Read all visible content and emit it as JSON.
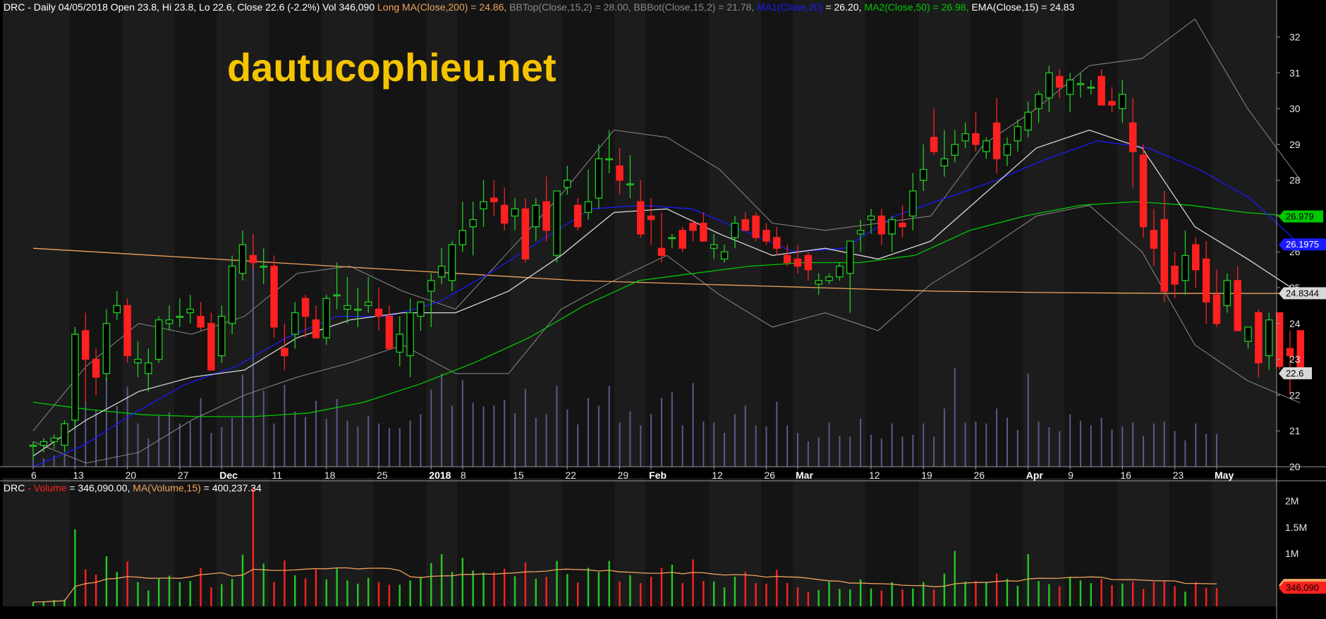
{
  "header": {
    "symbol": "DRC",
    "desc": " - Daily 04/05/2018 Open 23.8, Hi 23.8, Lo 22.6, Close 22.6 (-2.2%) Vol 346,090 ",
    "long_ma": "Long MA(Close,200) = 24.86,",
    "bbtop": " BBTop(Close,15,2) = 28.00,",
    "bbbot": " BBBot(Close,15,2) = 21.78,",
    "ma1_name": " MA1(Close,20)",
    "ma1_val": " = 26.20,",
    "ma2": " MA2(Close,50) = 26.98,",
    "ema": " EMA(Close,15) = 24.83"
  },
  "volume_header": {
    "symbol": "DRC",
    "vol_name": " - Volume",
    "vol_val": " = 346,090.00,",
    "ma_name": " MA(Volume,15)",
    "ma_val": " = 400,237.34"
  },
  "watermark": "dautucophieu.net",
  "colors": {
    "up": "#22cc22",
    "down": "#ff2020",
    "ma200": "#f0a35e",
    "ma20": "#1a1aff",
    "ma50": "#00c800",
    "ema": "#d8d8d8",
    "bb": "#8a8a8a",
    "volbars": "#5a5a8c",
    "watermark": "#f5c400"
  },
  "price_tags": [
    {
      "label": "26.979",
      "value": 26.979,
      "bg": "#00c800",
      "fg": "#000000"
    },
    {
      "label": "26.1975",
      "value": 26.1975,
      "bg": "#1a1aff",
      "fg": "#ffffff"
    },
    {
      "label": "24.8344",
      "value": 24.8344,
      "bg": "#d8d8d8",
      "fg": "#000000"
    },
    {
      "label": "22.6",
      "value": 22.6,
      "bg": "#d8d8d8",
      "fg": "#000000"
    }
  ],
  "volume_tags": [
    {
      "label": "400,237",
      "value": 400237,
      "bg": "#f0a35e",
      "fg": "#000000"
    },
    {
      "label": "346,090",
      "value": 346090,
      "bg": "#ff2020",
      "fg": "#000000"
    }
  ],
  "chart_data": {
    "type": "candlestick",
    "y_ticks": [
      20,
      21,
      22,
      23,
      24,
      25,
      26,
      27,
      28,
      29,
      30,
      31,
      32
    ],
    "ylim": [
      20,
      32.6
    ],
    "volume_ticks": [
      {
        "label": "1M",
        "value": 1000000
      },
      {
        "label": "1.5M",
        "value": 1500000
      },
      {
        "label": "2M",
        "value": 2000000
      }
    ],
    "volume_ylim": [
      0,
      2300000
    ],
    "x_labels": [
      {
        "label": "6",
        "index": 0,
        "bold": false
      },
      {
        "label": "13",
        "index": 4,
        "bold": false
      },
      {
        "label": "20",
        "index": 9,
        "bold": false
      },
      {
        "label": "27",
        "index": 14,
        "bold": false
      },
      {
        "label": "Dec",
        "index": 18,
        "bold": true
      },
      {
        "label": "11",
        "index": 23,
        "bold": false
      },
      {
        "label": "18",
        "index": 28,
        "bold": false
      },
      {
        "label": "25",
        "index": 33,
        "bold": false
      },
      {
        "label": "2018",
        "index": 38,
        "bold": true
      },
      {
        "label": "8",
        "index": 41,
        "bold": false
      },
      {
        "label": "15",
        "index": 46,
        "bold": false
      },
      {
        "label": "22",
        "index": 51,
        "bold": false
      },
      {
        "label": "29",
        "index": 56,
        "bold": false
      },
      {
        "label": "Feb",
        "index": 59,
        "bold": true
      },
      {
        "label": "12",
        "index": 65,
        "bold": false
      },
      {
        "label": "26",
        "index": 70,
        "bold": false
      },
      {
        "label": "Mar",
        "index": 73,
        "bold": true
      },
      {
        "label": "12",
        "index": 80,
        "bold": false
      },
      {
        "label": "19",
        "index": 85,
        "bold": false
      },
      {
        "label": "26",
        "index": 90,
        "bold": false
      },
      {
        "label": "Apr",
        "index": 95,
        "bold": true
      },
      {
        "label": "9",
        "index": 99,
        "bold": false
      },
      {
        "label": "16",
        "index": 104,
        "bold": false
      },
      {
        "label": "23",
        "index": 109,
        "bold": false
      },
      {
        "label": "May",
        "index": 113,
        "bold": true
      }
    ],
    "ohlc": [
      [
        20.6,
        20.7,
        20.2,
        20.6
      ],
      [
        20.6,
        20.8,
        20.4,
        20.7
      ],
      [
        20.7,
        20.9,
        20.5,
        20.8
      ],
      [
        20.6,
        21.3,
        20.4,
        21.2
      ],
      [
        21.3,
        23.9,
        21.1,
        23.7
      ],
      [
        23.8,
        24.3,
        21.8,
        23.0
      ],
      [
        23.0,
        23.3,
        22.0,
        22.5
      ],
      [
        22.6,
        24.4,
        22.4,
        24.0
      ],
      [
        24.3,
        24.9,
        24.1,
        24.5
      ],
      [
        24.5,
        24.7,
        22.9,
        23.1
      ],
      [
        22.9,
        23.5,
        22.5,
        23.0
      ],
      [
        22.6,
        23.3,
        22.1,
        22.9
      ],
      [
        23.0,
        24.2,
        22.9,
        24.1
      ],
      [
        24.0,
        24.5,
        23.8,
        24.1
      ],
      [
        24.2,
        24.7,
        23.9,
        24.2
      ],
      [
        24.3,
        24.8,
        24.0,
        24.4
      ],
      [
        24.2,
        24.6,
        23.8,
        23.9
      ],
      [
        24.0,
        24.3,
        22.7,
        22.7
      ],
      [
        23.1,
        24.5,
        22.9,
        24.2
      ],
      [
        24.0,
        25.9,
        23.7,
        25.6
      ],
      [
        25.4,
        26.6,
        25.2,
        26.2
      ],
      [
        25.9,
        26.5,
        25.5,
        25.7
      ],
      [
        25.6,
        26.1,
        25.1,
        25.6
      ],
      [
        25.6,
        25.9,
        23.6,
        23.9
      ],
      [
        23.3,
        24.0,
        22.7,
        23.1
      ],
      [
        23.7,
        24.6,
        23.3,
        24.3
      ],
      [
        24.7,
        24.8,
        23.6,
        24.2
      ],
      [
        24.1,
        24.5,
        23.6,
        23.6
      ],
      [
        23.6,
        24.8,
        23.4,
        24.7
      ],
      [
        24.8,
        25.7,
        24.4,
        24.8
      ],
      [
        24.4,
        25.3,
        24.0,
        24.5
      ],
      [
        24.4,
        25.0,
        23.9,
        24.4
      ],
      [
        24.5,
        25.3,
        24.3,
        24.6
      ],
      [
        24.4,
        25.0,
        23.8,
        24.2
      ],
      [
        24.2,
        24.5,
        23.3,
        23.3
      ],
      [
        23.2,
        24.2,
        22.8,
        23.7
      ],
      [
        23.1,
        24.7,
        22.5,
        24.3
      ],
      [
        24.2,
        24.6,
        23.8,
        24.6
      ],
      [
        24.9,
        25.4,
        23.9,
        25.2
      ],
      [
        25.3,
        26.1,
        25.1,
        25.6
      ],
      [
        25.2,
        26.3,
        24.9,
        26.2
      ],
      [
        26.2,
        27.4,
        26.0,
        26.6
      ],
      [
        26.7,
        27.4,
        25.9,
        26.9
      ],
      [
        27.2,
        28.0,
        26.7,
        27.4
      ],
      [
        27.5,
        28.0,
        27.0,
        27.4
      ],
      [
        27.3,
        27.8,
        26.6,
        26.8
      ],
      [
        27.0,
        27.5,
        26.6,
        27.2
      ],
      [
        27.2,
        27.5,
        25.7,
        25.8
      ],
      [
        26.7,
        27.5,
        26.3,
        27.3
      ],
      [
        27.4,
        28.1,
        26.3,
        26.6
      ],
      [
        25.9,
        27.5,
        25.7,
        27.7
      ],
      [
        27.8,
        28.4,
        27.6,
        28.0
      ],
      [
        27.3,
        27.5,
        26.6,
        26.7
      ],
      [
        27.1,
        28.3,
        26.9,
        27.4
      ],
      [
        27.5,
        29.0,
        27.2,
        28.6
      ],
      [
        28.6,
        29.4,
        28.2,
        28.6
      ],
      [
        28.4,
        28.9,
        27.6,
        28.0
      ],
      [
        27.9,
        28.7,
        27.5,
        27.9
      ],
      [
        27.4,
        28.0,
        26.4,
        26.5
      ],
      [
        27.0,
        27.5,
        26.2,
        26.9
      ],
      [
        26.1,
        27.1,
        25.7,
        25.9
      ],
      [
        26.4,
        26.5,
        26.1,
        26.4
      ],
      [
        26.6,
        26.7,
        26.0,
        26.1
      ],
      [
        26.8,
        26.9,
        26.3,
        26.6
      ],
      [
        26.8,
        27.1,
        26.3,
        26.3
      ],
      [
        26.1,
        26.5,
        25.8,
        26.2
      ],
      [
        25.8,
        26.2,
        25.7,
        26.0
      ],
      [
        26.4,
        27.0,
        26.1,
        26.8
      ],
      [
        26.9,
        27.1,
        26.6,
        26.6
      ],
      [
        27.0,
        27.1,
        26.3,
        26.4
      ],
      [
        26.6,
        26.8,
        26.2,
        26.3
      ],
      [
        26.4,
        26.7,
        25.9,
        26.1
      ],
      [
        25.9,
        26.2,
        25.6,
        25.7
      ],
      [
        25.8,
        26.2,
        25.4,
        25.6
      ],
      [
        25.9,
        26.0,
        25.2,
        25.5
      ],
      [
        25.1,
        25.4,
        24.8,
        25.2
      ],
      [
        25.2,
        25.4,
        25.1,
        25.3
      ],
      [
        25.3,
        25.7,
        25.2,
        25.6
      ],
      [
        25.4,
        26.3,
        24.3,
        26.3
      ],
      [
        26.5,
        26.9,
        26.0,
        26.6
      ],
      [
        26.9,
        27.2,
        26.5,
        27.0
      ],
      [
        27.0,
        27.2,
        26.2,
        26.5
      ],
      [
        26.5,
        27.0,
        26.0,
        26.9
      ],
      [
        26.8,
        27.3,
        26.4,
        26.7
      ],
      [
        27.0,
        28.2,
        26.6,
        27.7
      ],
      [
        28.0,
        29.0,
        27.7,
        28.3
      ],
      [
        29.2,
        30.0,
        28.7,
        28.8
      ],
      [
        28.4,
        29.4,
        28.1,
        28.6
      ],
      [
        28.7,
        29.4,
        28.5,
        29.0
      ],
      [
        29.1,
        29.6,
        28.9,
        29.3
      ],
      [
        29.3,
        29.9,
        28.8,
        29.0
      ],
      [
        28.8,
        29.2,
        28.6,
        29.1
      ],
      [
        29.6,
        30.3,
        28.2,
        28.6
      ],
      [
        28.7,
        29.2,
        28.4,
        29.0
      ],
      [
        29.1,
        29.7,
        28.8,
        29.5
      ],
      [
        29.4,
        30.2,
        29.2,
        29.9
      ],
      [
        30.0,
        30.5,
        29.6,
        30.4
      ],
      [
        30.3,
        31.2,
        29.9,
        31.0
      ],
      [
        30.9,
        31.1,
        30.3,
        30.6
      ],
      [
        30.4,
        31.0,
        29.9,
        30.8
      ],
      [
        30.7,
        31.0,
        30.3,
        30.7
      ],
      [
        30.6,
        30.8,
        30.4,
        30.6
      ],
      [
        30.9,
        31.1,
        30.1,
        30.1
      ],
      [
        30.2,
        30.6,
        29.9,
        30.1
      ]
    ],
    "ohlc_note": "",
    "ohlc_tail": [
      [
        30.0,
        30.8,
        29.6,
        30.4
      ],
      [
        29.6,
        30.3,
        27.8,
        28.8
      ],
      [
        28.7,
        29.0,
        26.4,
        26.7
      ],
      [
        26.6,
        27.2,
        25.6,
        26.1
      ],
      [
        26.9,
        27.7,
        24.6,
        24.9
      ],
      [
        25.6,
        26.0,
        24.7,
        25.1
      ],
      [
        25.2,
        26.6,
        24.8,
        25.9
      ],
      [
        26.2,
        26.4,
        25.0,
        25.5
      ],
      [
        25.8,
        26.3,
        24.0,
        24.6
      ],
      [
        24.8,
        25.5,
        23.9,
        24.0
      ],
      [
        24.5,
        25.4,
        24.3,
        25.2
      ],
      [
        25.2,
        25.6,
        23.8,
        23.8
      ],
      [
        23.5,
        23.8,
        23.3,
        23.9
      ],
      [
        24.3,
        24.4,
        22.5,
        22.9
      ],
      [
        23.1,
        24.3,
        22.7,
        24.1
      ],
      [
        24.3,
        24.3,
        22.7,
        22.8
      ],
      [
        23.3,
        23.8,
        22.0,
        23.1
      ],
      [
        23.8,
        23.8,
        22.6,
        22.6
      ]
    ],
    "ma200": [
      26.1,
      26.0,
      25.9,
      25.8,
      25.7,
      25.6,
      25.5,
      25.4,
      25.3,
      25.2,
      25.15,
      25.1,
      25.05,
      25.0,
      24.95,
      24.9,
      24.88,
      24.86,
      24.85,
      24.84,
      24.84,
      24.84
    ],
    "ma50": [
      21.8,
      21.6,
      21.45,
      21.4,
      21.4,
      21.5,
      21.8,
      22.3,
      22.9,
      23.6,
      24.5,
      25.2,
      25.4,
      25.6,
      25.7,
      25.7,
      25.9,
      26.6,
      27.0,
      27.3,
      27.4,
      27.3,
      27.1,
      26.98
    ],
    "ma20": [
      20.0,
      20.6,
      21.5,
      22.3,
      22.8,
      23.6,
      24.2,
      24.2,
      24.6,
      25.4,
      26.3,
      27.2,
      27.3,
      27.2,
      26.6,
      26.0,
      26.1,
      27.0,
      27.5,
      28.0,
      28.6,
      29.1,
      28.9,
      28.3,
      27.5,
      26.2
    ],
    "ema": [
      20.3,
      21.3,
      22.1,
      22.5,
      22.7,
      23.6,
      24.1,
      24.3,
      24.3,
      24.9,
      25.9,
      27.1,
      27.2,
      26.5,
      25.9,
      26.1,
      25.8,
      26.3,
      27.6,
      28.9,
      29.4,
      28.9,
      26.7,
      25.8,
      24.83
    ],
    "bbtop": [
      21.0,
      22.8,
      24.0,
      23.7,
      24.2,
      25.4,
      25.6,
      24.9,
      24.4,
      26.0,
      27.6,
      29.4,
      29.2,
      28.3,
      26.8,
      26.6,
      26.8,
      27.0,
      29.0,
      30.0,
      31.2,
      31.4,
      32.5,
      30.0,
      28.0
    ],
    "bbbot": [
      20.7,
      20.1,
      20.4,
      21.3,
      22.0,
      22.5,
      22.9,
      23.4,
      22.6,
      22.6,
      24.4,
      25.2,
      25.9,
      24.8,
      23.9,
      24.3,
      23.8,
      25.1,
      26.0,
      27.0,
      27.3,
      26.0,
      23.4,
      22.4,
      21.78
    ],
    "volume": [
      80,
      90,
      120,
      130,
      1460,
      700,
      600,
      950,
      650,
      850,
      460,
      300,
      540,
      580,
      460,
      480,
      730,
      360,
      420,
      520,
      980,
      2250,
      810,
      460,
      870,
      590,
      530,
      700,
      510,
      720,
      490,
      430,
      540,
      460,
      410,
      410,
      490,
      560,
      820,
      990,
      650,
      920,
      680,
      640,
      650,
      710,
      570,
      830,
      520,
      560,
      860,
      610,
      450,
      730,
      650,
      860,
      470,
      590,
      440,
      560,
      730,
      790,
      440,
      890,
      480,
      470,
      360,
      560,
      650,
      440,
      430,
      690,
      440,
      360,
      270,
      310,
      470,
      330,
      320,
      510,
      340,
      300,
      460,
      320,
      340,
      460,
      320,
      620,
      1050,
      470,
      480,
      460,
      620,
      520,
      390,
      990,
      480,
      420,
      380,
      560,
      490,
      440,
      520,
      400,
      430,
      470,
      330,
      460,
      480,
      380,
      280,
      460,
      350,
      346
    ]
  }
}
